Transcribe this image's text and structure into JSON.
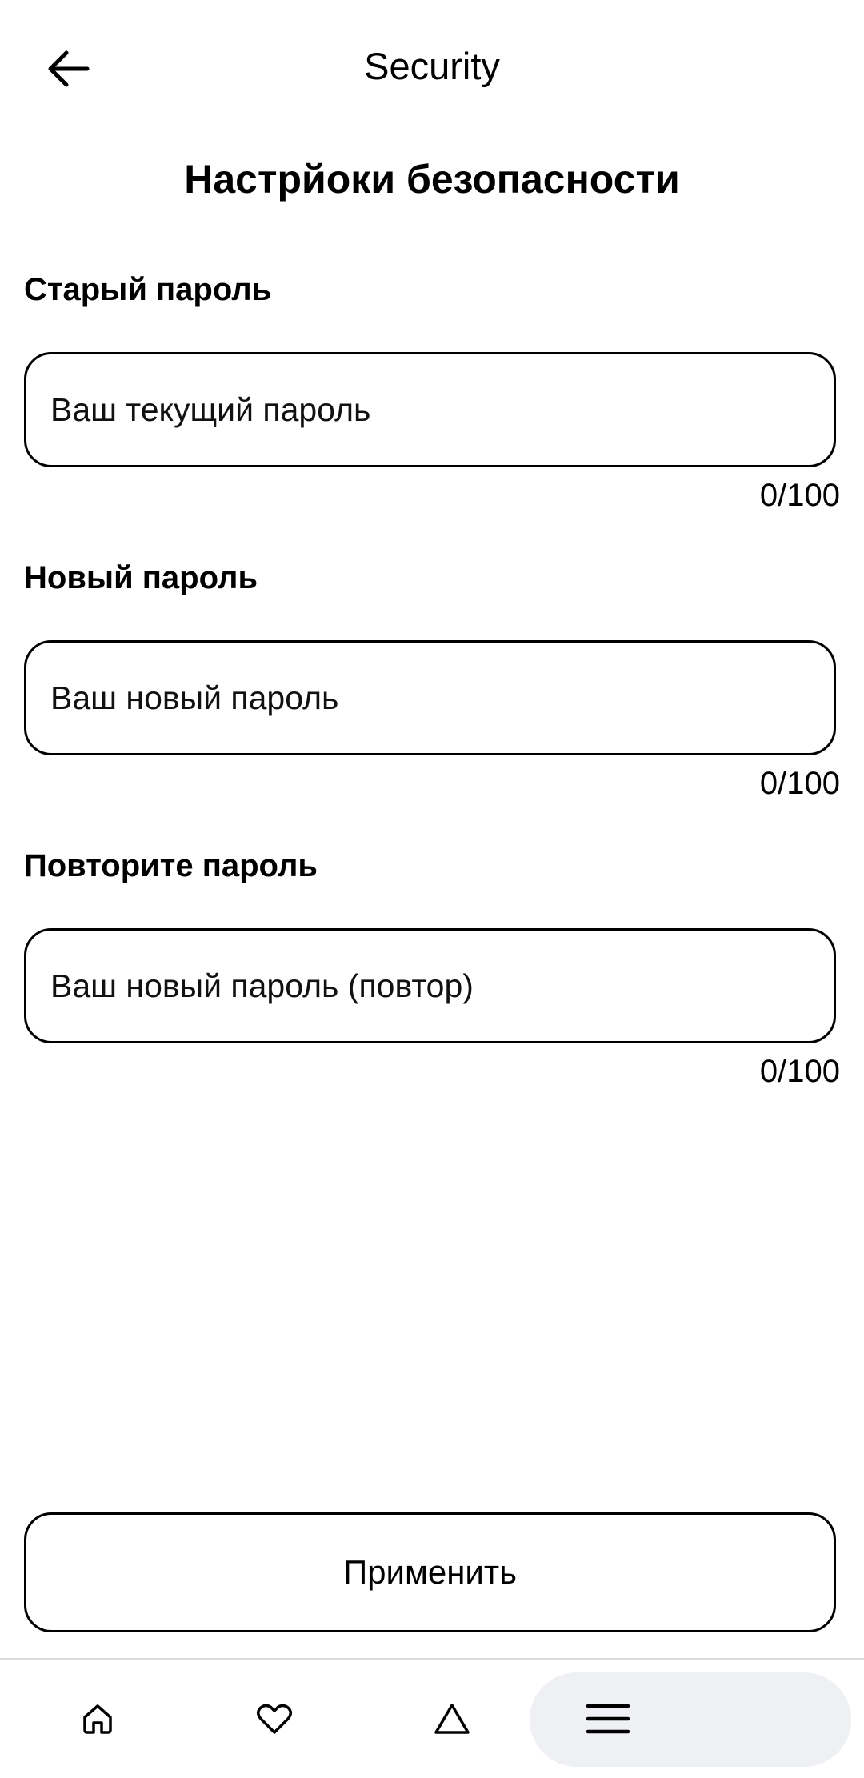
{
  "header": {
    "title": "Security",
    "back_icon": "arrow-left-icon"
  },
  "page": {
    "title": "Настрйоки безопасности"
  },
  "fields": {
    "old_password": {
      "label": "Старый пароль",
      "placeholder": "Ваш текущий пароль",
      "value": "",
      "counter": "0/100"
    },
    "new_password": {
      "label": "Новый пароль",
      "placeholder": "Ваш новый пароль",
      "value": "",
      "counter": "0/100"
    },
    "repeat_password": {
      "label": "Повторите пароль",
      "placeholder": "Ваш новый пароль (повтор)",
      "value": "",
      "counter": "0/100"
    }
  },
  "actions": {
    "apply_label": "Применить"
  },
  "bottom_nav": {
    "items": [
      {
        "icon": "home-icon"
      },
      {
        "icon": "heart-icon"
      },
      {
        "icon": "triangle-icon"
      },
      {
        "icon": "menu-icon",
        "active": true
      }
    ],
    "active_bg": "#eef0f3"
  }
}
